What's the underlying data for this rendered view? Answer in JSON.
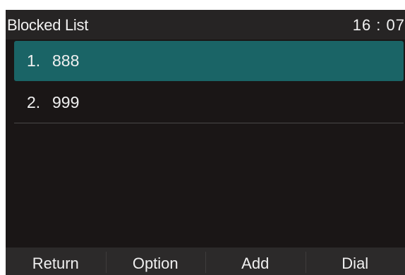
{
  "header": {
    "title": "Blocked List",
    "time": "16 : 07"
  },
  "list": {
    "items": [
      {
        "index": "1.",
        "number": "888",
        "selected": true
      },
      {
        "index": "2.",
        "number": "999",
        "selected": false
      }
    ]
  },
  "softkeys": {
    "return_label": "Return",
    "option_label": "Option",
    "add_label": "Add",
    "dial_label": "Dial"
  },
  "colors": {
    "background": "#1a1616",
    "titlebar": "#262424",
    "selection": "#1a6466",
    "softkey_bar": "#2c2a2a",
    "text": "#f0f0f0"
  }
}
